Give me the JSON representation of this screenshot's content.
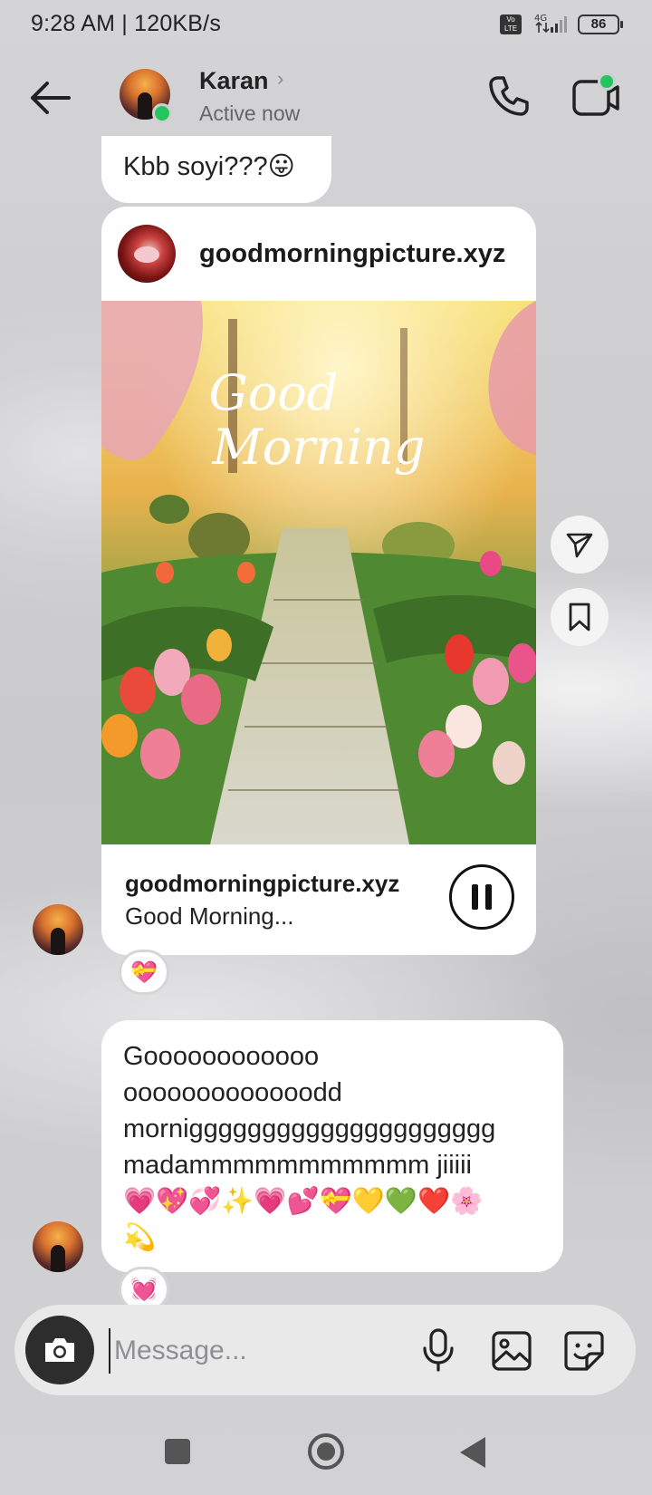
{
  "status_bar": {
    "time": "9:28 AM | 120KB/s",
    "network": "4G",
    "volte": "Vo LTE",
    "battery": "86"
  },
  "header": {
    "contact_name": "Karan",
    "status": "Active now"
  },
  "messages": {
    "prev_text": "Kbb soyi???😛",
    "shared_post": {
      "account": "goodmorningpicture.xyz",
      "image_script_line1": "Good",
      "image_script_line2": "Morning",
      "footer_account": "goodmorningpicture.xyz",
      "caption": "Good Morning..."
    },
    "reaction_1": "💝",
    "text_message": "Goooooooooooo\nooooooooooooodd\nmorniggggggggggggggggggggg\nmadammmmmmmmmmm jiiiii\n💗💖💞✨💗💕💝💛💚❤️🌸\n💫",
    "reaction_2": "💓"
  },
  "composer": {
    "placeholder": "Message..."
  },
  "colors": {
    "online": "#22c55e",
    "bubble": "#ffffff",
    "background": "#cfcfd1"
  }
}
